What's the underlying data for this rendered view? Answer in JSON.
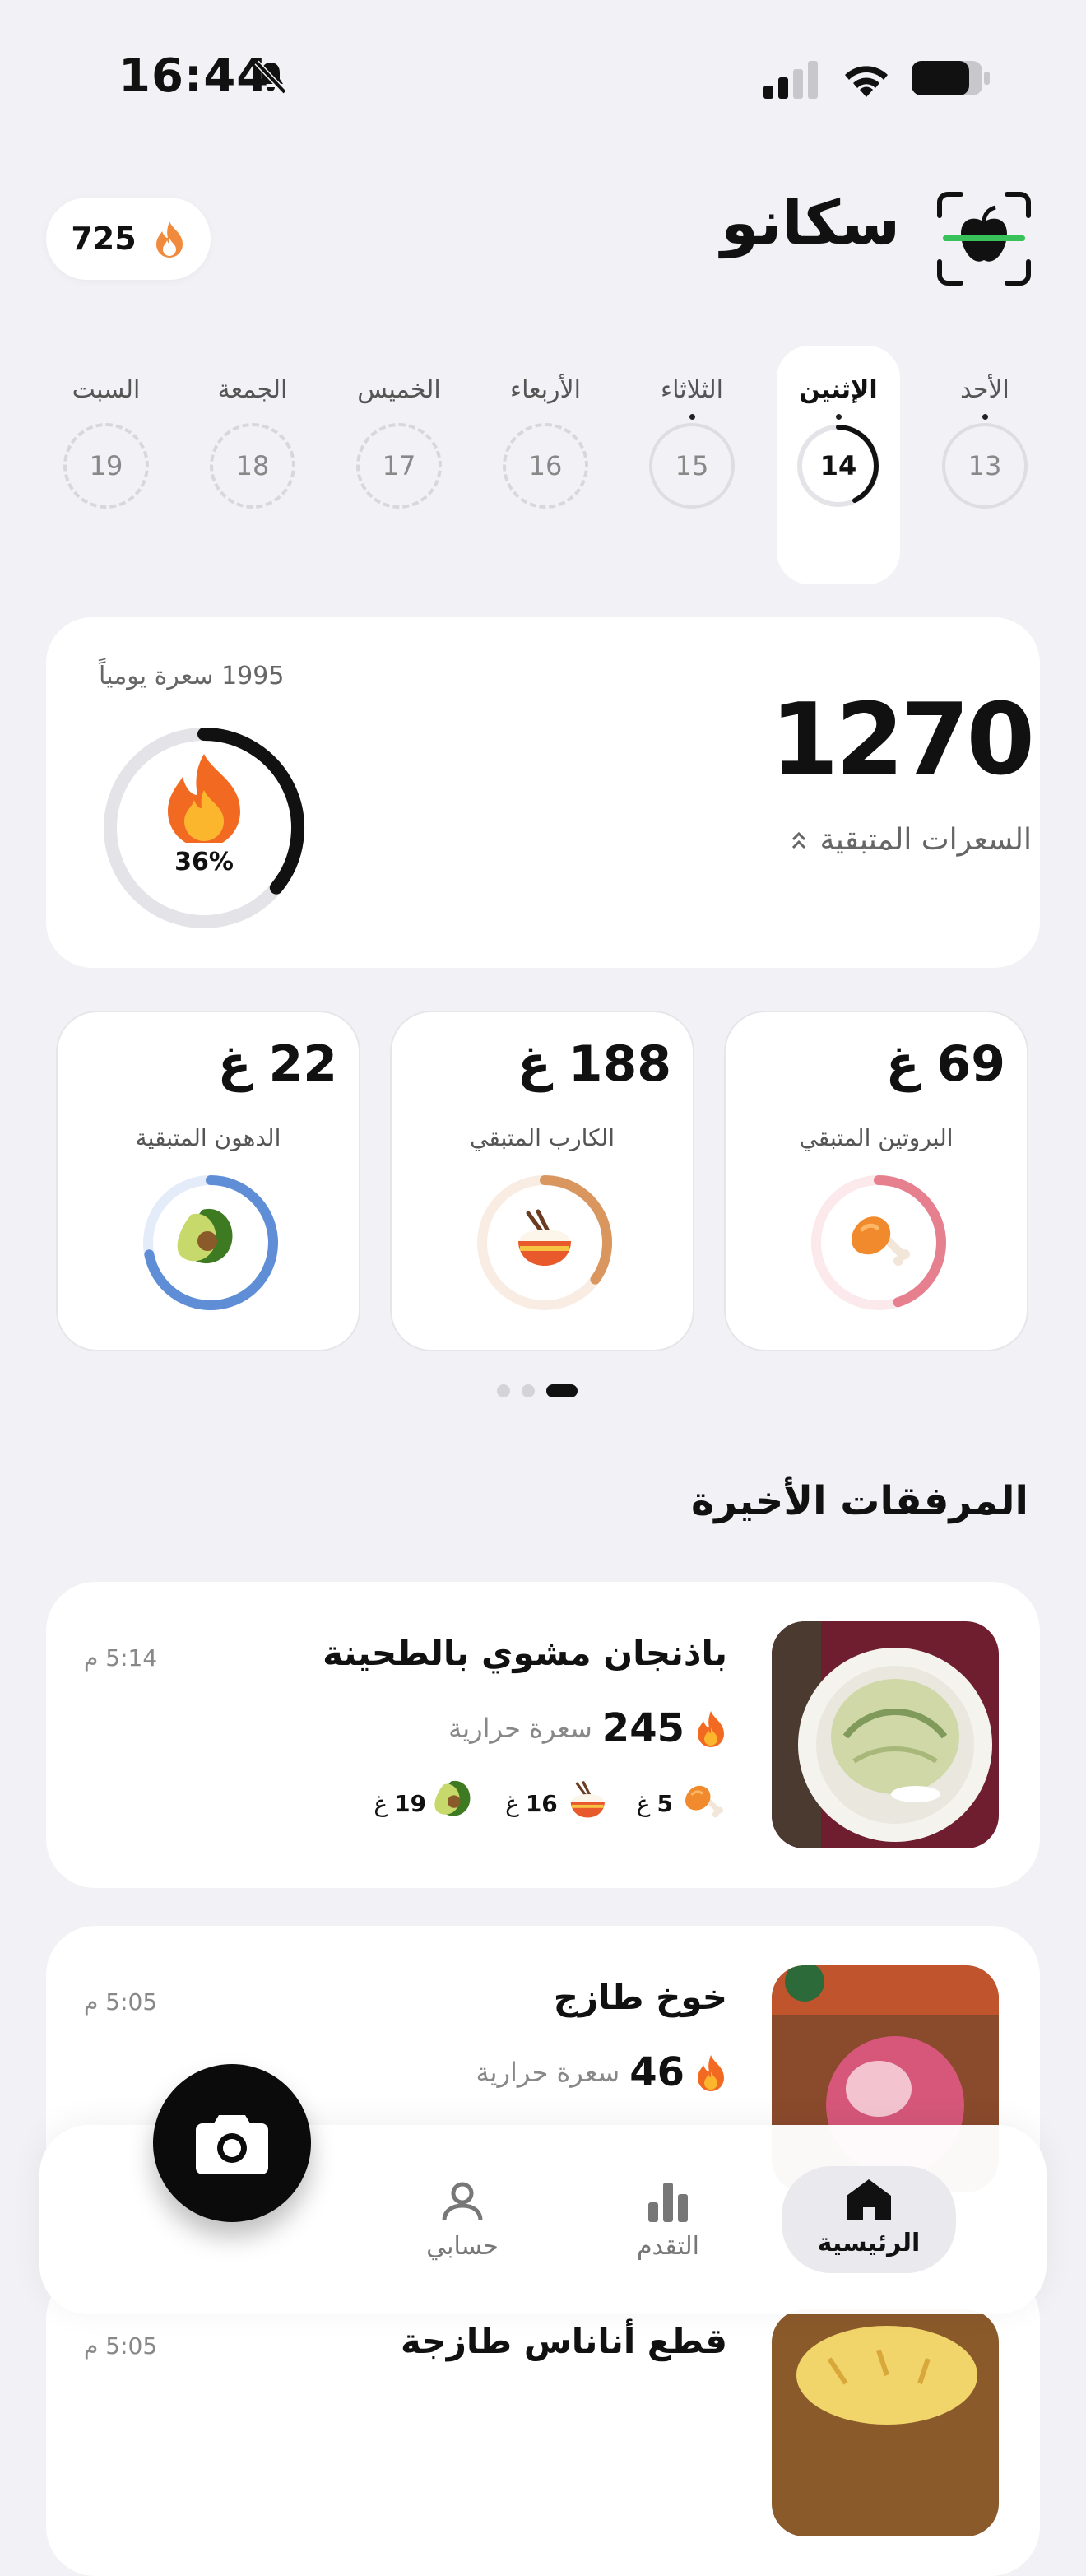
{
  "status_bar": {
    "time": "16:44",
    "icons": [
      "bell-slash-icon",
      "signal-icon",
      "wifi-icon",
      "battery-icon"
    ]
  },
  "header": {
    "title": "سكانو",
    "streak": "725",
    "logo": "apple-scan-icon"
  },
  "week": [
    {
      "name": "الأحد",
      "num": "13",
      "dot": true,
      "selected": false
    },
    {
      "name": "الإثنين",
      "num": "14",
      "dot": true,
      "selected": true
    },
    {
      "name": "الثلاثاء",
      "num": "15",
      "dot": true,
      "selected": false
    },
    {
      "name": "الأربعاء",
      "num": "16",
      "dot": false,
      "selected": false
    },
    {
      "name": "الخميس",
      "num": "17",
      "dot": false,
      "selected": false
    },
    {
      "name": "الجمعة",
      "num": "18",
      "dot": false,
      "selected": false
    },
    {
      "name": "السبت",
      "num": "19",
      "dot": false,
      "selected": false
    }
  ],
  "calories": {
    "remaining": "1270",
    "label": "السعرات المتبقية",
    "goal": "1995 سعرة يومياً",
    "percent_text": "36%",
    "progress": 0.36
  },
  "macros": [
    {
      "value": "69 غ",
      "label": "البروتين المتبقي",
      "icon": "chicken-leg-icon",
      "color": "#e7808e",
      "track": "#fbe9ec",
      "progress": 0.45
    },
    {
      "value": "188 غ",
      "label": "الكارب المتبقي",
      "icon": "rice-bowl-icon",
      "color": "#d9975f",
      "track": "#f9ece2",
      "progress": 0.35
    },
    {
      "value": "22 غ",
      "label": "الدهون المتبقية",
      "icon": "avocado-icon",
      "color": "#5f8ed6",
      "track": "#e3ecf8",
      "progress": 0.72
    }
  ],
  "pager": {
    "count": 3,
    "active": 2
  },
  "recent": {
    "title": "المرفقات الأخيرة",
    "kcal_unit": "سعرة حرارية",
    "gram_unit": "غ",
    "items": [
      {
        "name": "باذنجان مشوي بالطحينة",
        "time": "5:14 م",
        "kcal": "245",
        "protein": "5",
        "carbs": "16",
        "fat": "19",
        "photo": "plate"
      },
      {
        "name": "خوخ طازج",
        "time": "5:05 م",
        "kcal": "46",
        "protein": "",
        "carbs": "",
        "fat": "",
        "photo": "peach"
      },
      {
        "name": "قطع أناناس طازجة",
        "time": "5:05 م",
        "kcal": "",
        "protein": "",
        "carbs": "",
        "fat": "",
        "photo": "pineapple"
      }
    ]
  },
  "nav": {
    "home": "الرئيسية",
    "progress": "التقدم",
    "account": "حسابي",
    "camera": "camera-icon"
  }
}
